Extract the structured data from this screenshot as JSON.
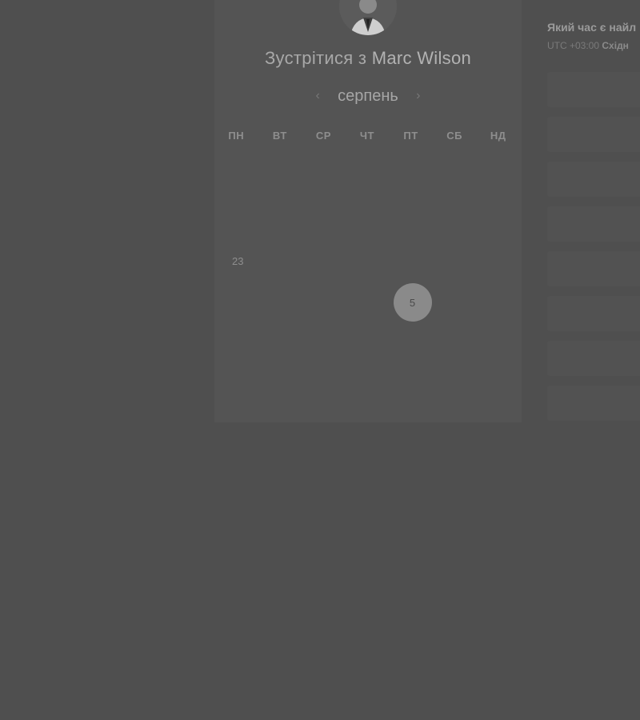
{
  "booking": {
    "title_prefix": "Зустрітися з",
    "host_name": "Marc Wilson",
    "month": "серпень"
  },
  "weekdays": [
    "ПН",
    "ВТ",
    "СР",
    "ЧТ",
    "ПТ",
    "СБ",
    "НД"
  ],
  "days": [
    [
      "",
      "",
      "",
      "",
      "",
      "",
      ""
    ],
    [
      "",
      "",
      "",
      "",
      "",
      "",
      ""
    ],
    [
      "23",
      "",
      "",
      "",
      "",
      "",
      ""
    ],
    [
      "",
      "",
      "",
      "",
      "5",
      "",
      ""
    ],
    [
      "",
      "",
      "",
      "",
      "",
      "",
      ""
    ]
  ],
  "selected_day": "5",
  "timezone_panel": {
    "question": "Який час є найл",
    "tz_code": "UTC +03:00",
    "tz_name": "Східн"
  },
  "colors": {
    "background": "#4f4f4f",
    "card": "#545454",
    "selected_day": "#8a8a8a"
  }
}
